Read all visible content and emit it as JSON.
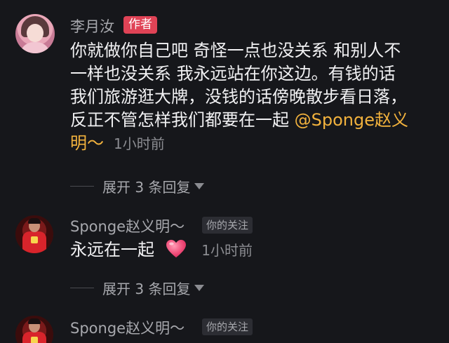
{
  "author_comment": {
    "username": "李月汝",
    "badge": "作者",
    "lines": [
      "你就做你自己吧 奇怪一点也没关系 和别人不",
      "一样也没关系 我永远站在你这边。有钱的话",
      "我们旅游逛大牌，没钱的话傍晚散步看日落，",
      "反正不管怎样我们都要在一起 "
    ],
    "mention_part1": "@Sponge赵义",
    "mention_part2": "明～",
    "time": "1小时前",
    "expand_label": "展开 3 条回复"
  },
  "reply_comment": {
    "username": "Sponge赵义明～",
    "badge": "你的关注",
    "text": "永远在一起",
    "emoji": "heart-emoji",
    "time": "1小时前",
    "expand_label": "展开 3 条回复"
  },
  "third_comment": {
    "username": "Sponge赵义明～",
    "badge": "你的关注"
  },
  "colors": {
    "background": "#16171b",
    "mention": "#f2b23d",
    "author_badge": "#e04356",
    "heart": "#f04f7b"
  }
}
